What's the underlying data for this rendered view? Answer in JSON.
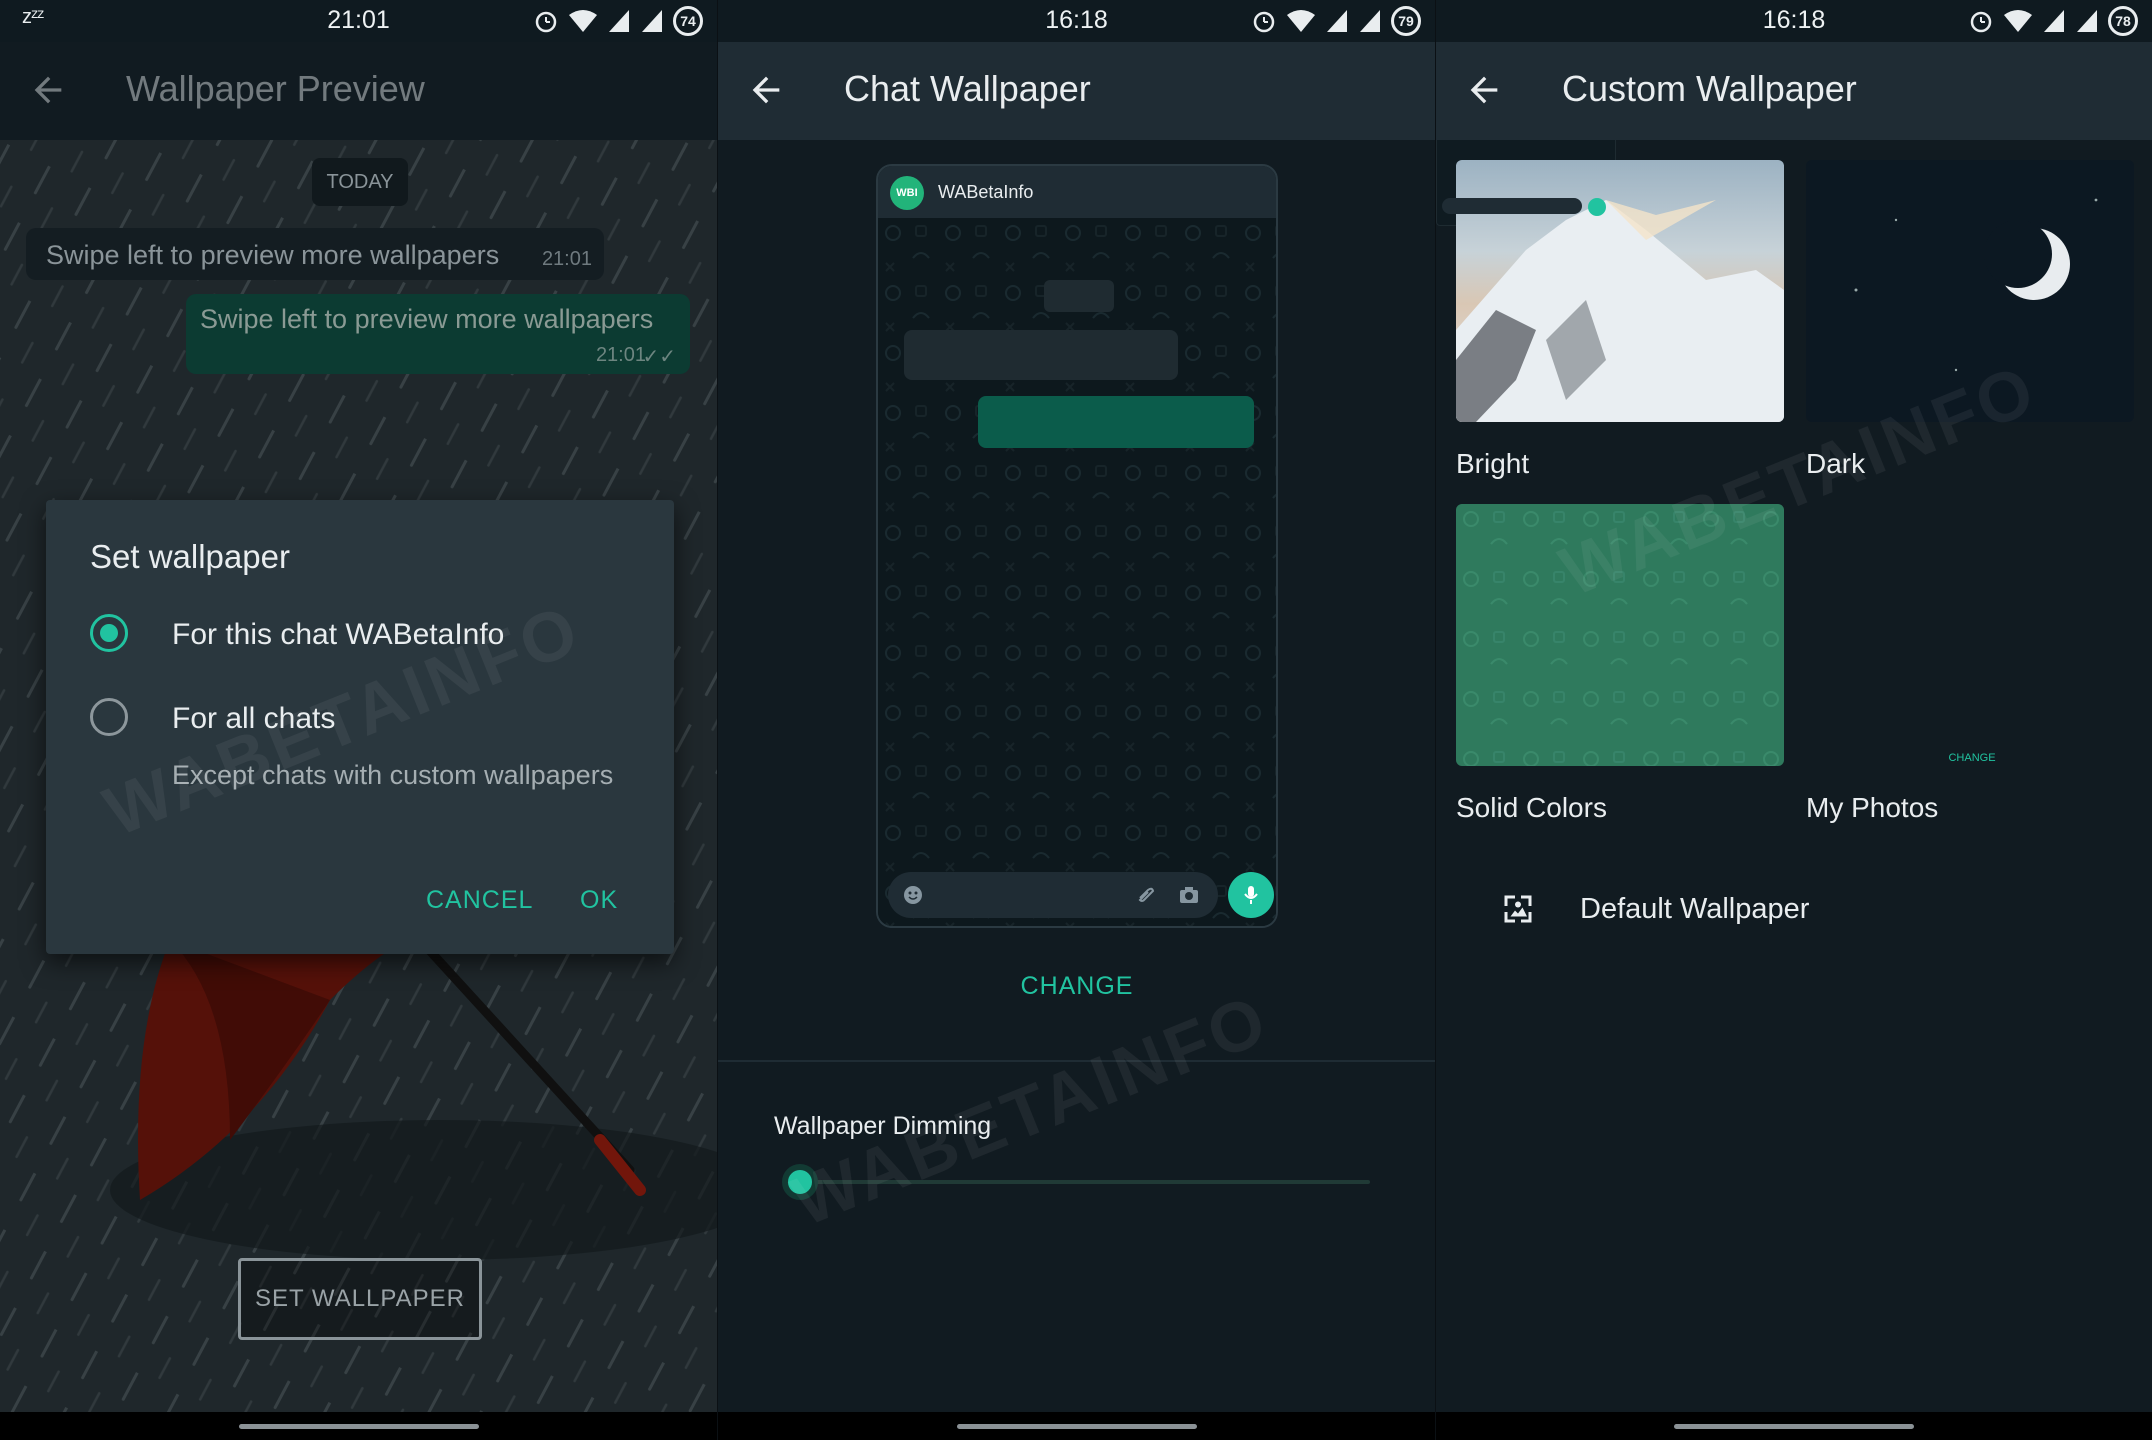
{
  "watermark": "WABETAINFO",
  "panels": {
    "preview": {
      "status": {
        "time": "21:01",
        "left": "zᶻᶻ",
        "battery": "74"
      },
      "title": "Wallpaper Preview",
      "date_chip": "TODAY",
      "incoming": {
        "text": "Swipe left to preview more wallpapers",
        "time": "21:01"
      },
      "outgoing": {
        "text": "Swipe left to preview more wallpapers",
        "time": "21:01"
      },
      "dialog": {
        "title": "Set wallpaper",
        "options": [
          {
            "label": "For this chat WABetaInfo",
            "selected": true
          },
          {
            "label": "For all chats",
            "sublabel": "Except chats with custom wallpapers",
            "selected": false
          }
        ],
        "cancel": "CANCEL",
        "ok": "OK"
      },
      "set_button": "SET WALLPAPER"
    },
    "chat": {
      "status": {
        "time": "16:18",
        "battery": "79"
      },
      "title": "Chat Wallpaper",
      "preview_avatar": "WBI",
      "preview_name": "WABetaInfo",
      "change": "CHANGE",
      "dimming_label": "Wallpaper Dimming",
      "dimming_value": 0
    },
    "custom": {
      "status": {
        "time": "16:18",
        "battery": "78"
      },
      "title": "Custom Wallpaper",
      "tiles": [
        "Bright",
        "Dark",
        "Solid Colors",
        "My Photos"
      ],
      "myphotos_change": "CHANGE",
      "default": "Default Wallpaper"
    }
  },
  "colors": {
    "accent": "#21c3a0",
    "appbar": "#1f2c34",
    "background": "#111b21"
  }
}
